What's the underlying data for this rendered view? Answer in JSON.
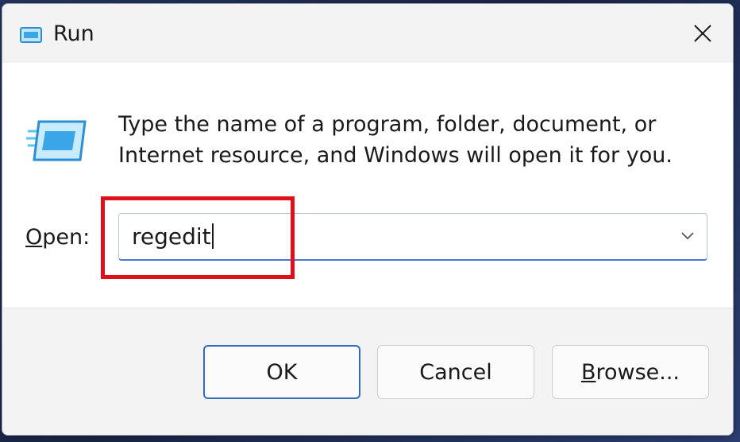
{
  "window": {
    "title": "Run",
    "icon": "run-icon"
  },
  "content": {
    "description": "Type the name of a program, folder, document, or Internet resource, and Windows will open it for you.",
    "open_label_accel": "O",
    "open_label_rest": "pen:",
    "combo_value": "regedit"
  },
  "buttons": {
    "ok": "OK",
    "cancel": "Cancel",
    "browse_accel": "B",
    "browse_rest": "rowse..."
  },
  "colors": {
    "highlight": "#e0101a",
    "focus": "#2f6bbf"
  }
}
